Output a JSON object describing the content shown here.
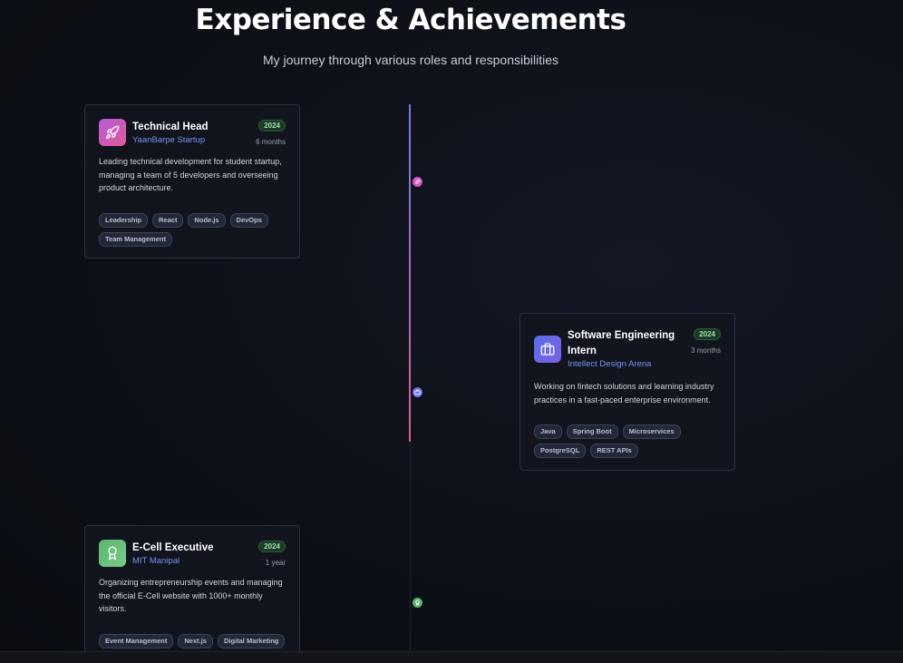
{
  "header": {
    "title": "Experience & Achievements",
    "subtitle": "My journey through various roles and responsibilities"
  },
  "experiences": [
    {
      "icon": "rocket-icon",
      "role": "Technical Head",
      "company": "YaanBarpe Startup",
      "year": "2024",
      "duration": "6 months",
      "description": "Leading technical development for student startup, managing a team of 5 developers and overseeing product architecture.",
      "tags": [
        "Leadership",
        "React",
        "Node.js",
        "DevOps",
        "Team Management"
      ]
    },
    {
      "icon": "briefcase-icon",
      "role": "Software Engineering Intern",
      "company": "Intellect Design Arena",
      "year": "2024",
      "duration": "3 months",
      "description": "Working on fintech solutions and learning industry practices in a fast-paced enterprise environment.",
      "tags": [
        "Java",
        "Spring Boot",
        "Microservices",
        "PostgreSQL",
        "REST APIs"
      ]
    },
    {
      "icon": "award-icon",
      "role": "E-Cell Executive",
      "company": "MIT Manipal",
      "year": "2024",
      "duration": "1 year",
      "description": "Organizing entrepreneurship events and managing the official E-Cell website with 1000+ monthly visitors.",
      "tags": [
        "Event Management",
        "Next.js",
        "Digital Marketing"
      ]
    }
  ],
  "colors": {
    "accent_blue": "#6f95f0",
    "rocket_gradient": "#b45cd6",
    "briefcase_gradient": "#5a6ee6",
    "award_gradient": "#5ab86b"
  }
}
